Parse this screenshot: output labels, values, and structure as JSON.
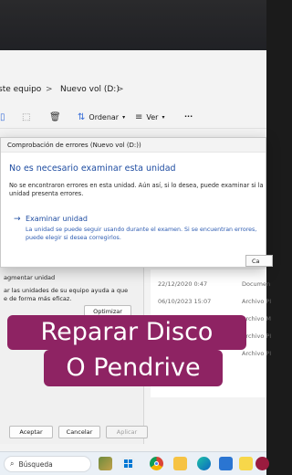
{
  "explorer": {
    "breadcrumb_this_pc": "ste equipo",
    "breadcrumb_separator": ">",
    "breadcrumb_drive": "Nuevo vol (D:)",
    "breadcrumb_chevron": ">",
    "toolbar": {
      "sort_label": "Ordenar",
      "view_label": "Ver",
      "more_label": "···"
    },
    "files": [
      {
        "date": "22/12/2020 0:47",
        "type": "Documen"
      },
      {
        "date": "06/10/2023 15:07",
        "type": "Archivo PI"
      },
      {
        "date": "",
        "type": "Archivo M"
      },
      {
        "date": "",
        "type": "Archivo PI"
      },
      {
        "date": "",
        "type": "Archivo PI"
      }
    ]
  },
  "properties": {
    "defrag_title": "agmentar unidad",
    "defrag_desc_1": "ar las unidades de su equipo ayuda a que",
    "defrag_desc_2": "e de forma más eficaz.",
    "optimize_button": "Optimizar",
    "accept_button": "Aceptar",
    "cancel_button": "Cancelar",
    "apply_button": "Aplicar"
  },
  "dialog": {
    "title": "Comprobación de errores (Nuevo vol (D:))",
    "heading": "No es necesario examinar esta unidad",
    "description": "No se encontraron errores en esta unidad. Aún así, si lo desea, puede examinar si la unidad presenta errores.",
    "action_arrow": "→",
    "action_label": "Examinar unidad",
    "action_sub": "La unidad se puede seguir usando durante el examen. Si se encuentran errores, puede elegir si desea corregirlos.",
    "cancel_button": "Ca"
  },
  "caption": {
    "line1": "Reparar Disco",
    "line2": "O Pendrive"
  },
  "taskbar": {
    "search_placeholder": "Búsqueda",
    "pinned_icons": [
      "landscape-icon",
      "windows-icon",
      "chrome-icon",
      "folder-icon",
      "edge-icon",
      "mail-icon",
      "sticky-icon",
      "app-a-icon"
    ]
  },
  "colors": {
    "caption_bg": "#8e2363",
    "link_blue": "#1e4ca1"
  }
}
